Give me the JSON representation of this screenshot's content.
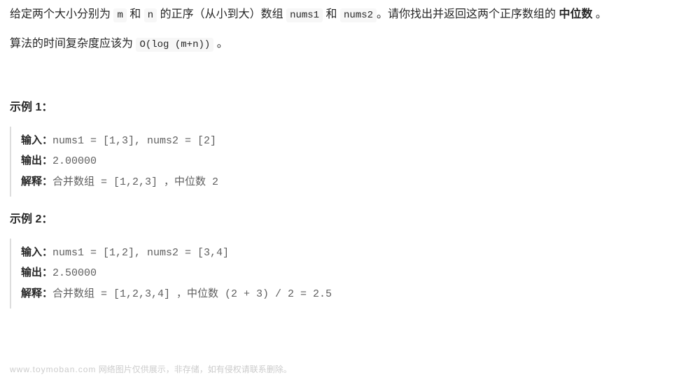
{
  "problem": {
    "para1_pre": "给定两个大小分别为 ",
    "code_m": "m",
    "para1_mid1": " 和 ",
    "code_n": "n",
    "para1_mid2": " 的正序（从小到大）数组 ",
    "code_nums1": "nums1",
    "para1_mid3": " 和 ",
    "code_nums2": "nums2",
    "para1_mid4": "。请你找出并返回这两个正序数组的 ",
    "bold_median": "中位数",
    "para1_post": " 。",
    "para2_pre": "算法的时间复杂度应该为 ",
    "code_complexity": "O(log (m+n))",
    "para2_post": " 。"
  },
  "example1_title": "示例 1：",
  "example2_title": "示例 2：",
  "labels": {
    "input": "输入：",
    "output": "输出：",
    "explain": "解释："
  },
  "ex1": {
    "input": "nums1 = [1,3], nums2 = [2]",
    "output": "2.00000",
    "explain": "合并数组 = [1,2,3] ，中位数 2"
  },
  "ex2": {
    "input": "nums1 = [1,2], nums2 = [3,4]",
    "output": "2.50000",
    "explain": "合并数组 = [1,2,3,4] ，中位数 (2 + 3) / 2 = 2.5"
  },
  "watermark": {
    "domain": "www.toymoban.com",
    "note": " 网络图片仅供展示，非存储，如有侵权请联系删除。"
  }
}
